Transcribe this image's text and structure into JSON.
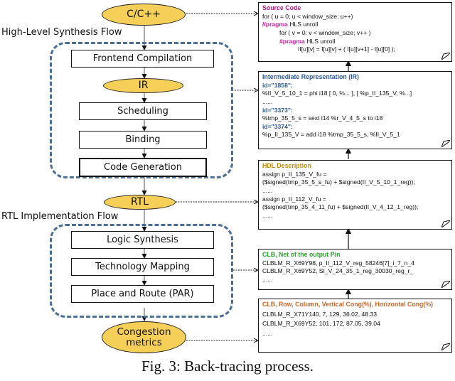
{
  "flow": {
    "input_node": "C/C++",
    "hls_label": "High-Level Synthesis Flow",
    "hls_steps": [
      "Frontend Compilation",
      "Scheduling",
      "Binding",
      "Code Generation"
    ],
    "ir_node": "IR",
    "rtl_node": "RTL",
    "rtl_label": "RTL Implementation Flow",
    "rtl_steps": [
      "Logic Synthesis",
      "Technology Mapping",
      "Place and Route (PAR)"
    ],
    "output_node": [
      "Congestion",
      "metrics"
    ]
  },
  "notes": {
    "source": {
      "title": "Source Code",
      "title_color": "#c0188f",
      "lines": [
        "for ( u = 0; u < window_size; u++)",
        "HLS unroll",
        "for ( v = 0; v < window_size; v++ )",
        "HLS unroll",
        "II[u][v] = I[u][v] + ( I[u][v+1] - I[u][0] );"
      ],
      "pragma_a": "//pragma",
      "pragma_b": "#pragma"
    },
    "ir": {
      "title": "Intermediate Representation (IR)",
      "title_color": "#2c5aa0",
      "id1": "id=\"1858\":",
      "line1": "%II_V_5_10_1 = phi i18 [ 0, %... ], [ %p_II_135_V, %...]",
      "dots": "......",
      "id2": "id=\"3373\":",
      "line2": "%tmp_35_5_s = sext i14 %r_V_4_5_s to i18",
      "id3": "id=\"3374\":",
      "line3": "%p_II_135_V = add i18 %tmp_35_5_s, %II_V_5_1"
    },
    "hdl": {
      "title": "HDL Description",
      "title_color": "#c48a0a",
      "lines": [
        "assign p_II_135_V_fu =",
        "($signed(tmp_35_5_s_fu) + $signed(II_V_5_10_1_reg));",
        "......",
        "assign p_II_112_V_fu =",
        "($signed(tmp_35_4_11_fu) + $signed(II_V_4_12_1_reg));",
        "......"
      ]
    },
    "clb": {
      "title": "CLB, Net of the output Pin",
      "title_color": "#2aa52a",
      "lines": [
        "CLBLM_R_X69Y98, p_II_112_V_reg_58246[7]_i_7_n_4",
        "CLBLM_R_X69Y52, SI_V_24_35_1_reg_30030_reg_r_",
        "......"
      ]
    },
    "cong": {
      "title": "CLB, Row, Column, Vertical Cong(%), Horizontal Cong(%)",
      "title_color": "#d0682a",
      "lines": [
        "CLBLM_R_X71Y140, 7, 129, 36.02, 48.33",
        "CLBLM_R_X69Y52, 101, 172, 87.05, 39.04",
        "......"
      ]
    }
  },
  "caption": "Fig. 3: Back-tracing process."
}
